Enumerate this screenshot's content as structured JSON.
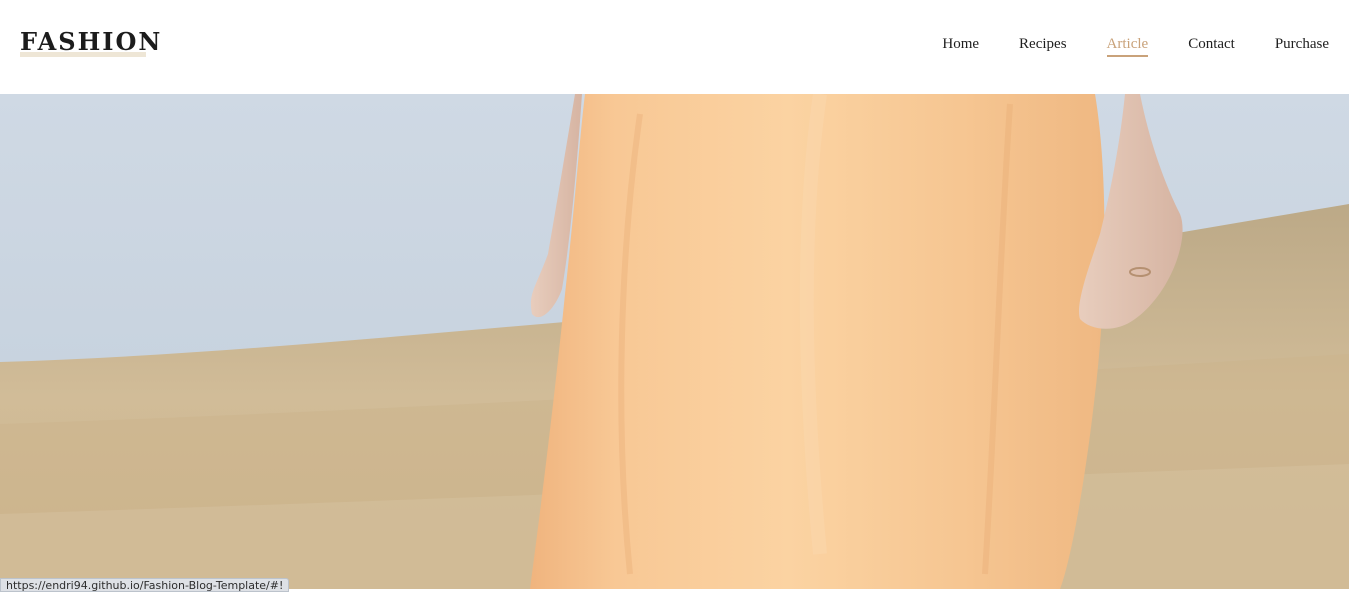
{
  "brand": {
    "logo": "FASHION"
  },
  "nav": {
    "items": [
      {
        "label": "Home",
        "active": false
      },
      {
        "label": "Recipes",
        "active": false
      },
      {
        "label": "Article",
        "active": true
      },
      {
        "label": "Contact",
        "active": false
      },
      {
        "label": "Purchase",
        "active": false
      }
    ]
  },
  "status_bar": {
    "url": "https://endri94.github.io/Fashion-Blog-Template/#!"
  },
  "colors": {
    "accent": "#c9a27a",
    "text": "#1e1e1e",
    "sky": "#cdd7e2",
    "field": "#cdb48a",
    "dress": "#f6c791"
  }
}
